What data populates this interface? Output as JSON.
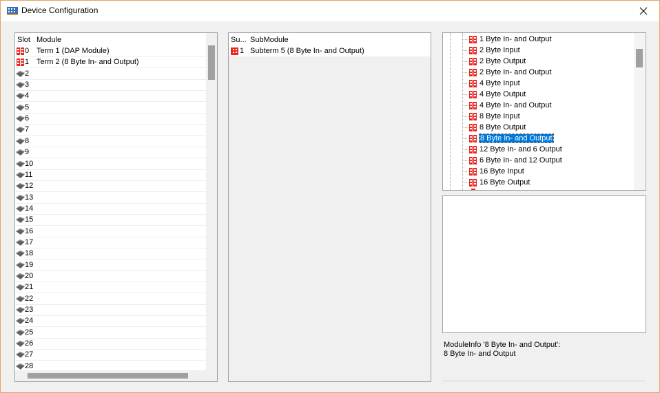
{
  "window": {
    "title": "Device Configuration"
  },
  "slots": {
    "headers": {
      "slot": "Slot",
      "module": "Module"
    },
    "rows": [
      {
        "slot": "0",
        "module": "Term 1 (DAP Module)",
        "filled": true
      },
      {
        "slot": "1",
        "module": "Term 2 (8 Byte In- and Output)",
        "filled": true
      },
      {
        "slot": "2",
        "module": "",
        "filled": false
      },
      {
        "slot": "3",
        "module": "",
        "filled": false
      },
      {
        "slot": "4",
        "module": "",
        "filled": false
      },
      {
        "slot": "5",
        "module": "",
        "filled": false
      },
      {
        "slot": "6",
        "module": "",
        "filled": false
      },
      {
        "slot": "7",
        "module": "",
        "filled": false
      },
      {
        "slot": "8",
        "module": "",
        "filled": false
      },
      {
        "slot": "9",
        "module": "",
        "filled": false
      },
      {
        "slot": "10",
        "module": "",
        "filled": false
      },
      {
        "slot": "11",
        "module": "",
        "filled": false
      },
      {
        "slot": "12",
        "module": "",
        "filled": false
      },
      {
        "slot": "13",
        "module": "",
        "filled": false
      },
      {
        "slot": "14",
        "module": "",
        "filled": false
      },
      {
        "slot": "15",
        "module": "",
        "filled": false
      },
      {
        "slot": "16",
        "module": "",
        "filled": false
      },
      {
        "slot": "17",
        "module": "",
        "filled": false
      },
      {
        "slot": "18",
        "module": "",
        "filled": false
      },
      {
        "slot": "19",
        "module": "",
        "filled": false
      },
      {
        "slot": "20",
        "module": "",
        "filled": false
      },
      {
        "slot": "21",
        "module": "",
        "filled": false
      },
      {
        "slot": "22",
        "module": "",
        "filled": false
      },
      {
        "slot": "23",
        "module": "",
        "filled": false
      },
      {
        "slot": "24",
        "module": "",
        "filled": false
      },
      {
        "slot": "25",
        "module": "",
        "filled": false
      },
      {
        "slot": "26",
        "module": "",
        "filled": false
      },
      {
        "slot": "27",
        "module": "",
        "filled": false
      },
      {
        "slot": "28",
        "module": "",
        "filled": false
      }
    ]
  },
  "submodules": {
    "headers": {
      "sub": "Su...",
      "submodule": "SubModule"
    },
    "rows": [
      {
        "sub": "1",
        "submodule": "Subterm 5 (8 Byte In- and Output)"
      }
    ]
  },
  "catalog": {
    "items": [
      "1 Byte In- and Output",
      "2 Byte Input",
      "2 Byte Output",
      "2 Byte In- and Output",
      "4 Byte Input",
      "4 Byte Output",
      "4 Byte In- and Output",
      "8 Byte Input",
      "8 Byte Output",
      "8 Byte In- and Output",
      "12 Byte In- and 6 Output",
      "6 Byte In- and 12 Output",
      "16 Byte Input",
      "16 Byte Output"
    ],
    "selected_index": 9
  },
  "info": {
    "line1": "ModuleInfo '8 Byte In- and Output':",
    "line2": "8 Byte In- and Output"
  },
  "colors": {
    "module_red": "#e8281e",
    "selection": "#0078d7",
    "empty_slot": "#606060"
  }
}
